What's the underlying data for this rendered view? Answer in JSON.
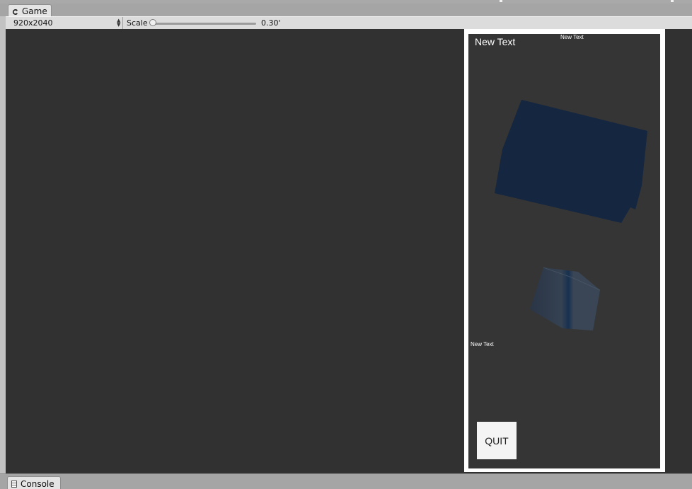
{
  "tabs": {
    "game_label": "Game",
    "console_label": "Console"
  },
  "toolbar": {
    "resolution": "920x2040",
    "scale_label": "Scale",
    "scale_value": "0.30'",
    "scale_fraction": 0.0
  },
  "game": {
    "text_large": "New Text",
    "text_small_top": "New Text",
    "text_small_mid": "New Text",
    "quit_label": "QUIT"
  },
  "icons": {
    "game_tab": "unity-game-icon",
    "console_tab": "console-log-icon",
    "dropdown": "up-down-arrows-icon"
  },
  "colors": {
    "viewport_bg": "#313131",
    "game_bg": "#353535",
    "frame": "#ffffff",
    "slab": "#142640",
    "cube": "#2e3a4a"
  }
}
